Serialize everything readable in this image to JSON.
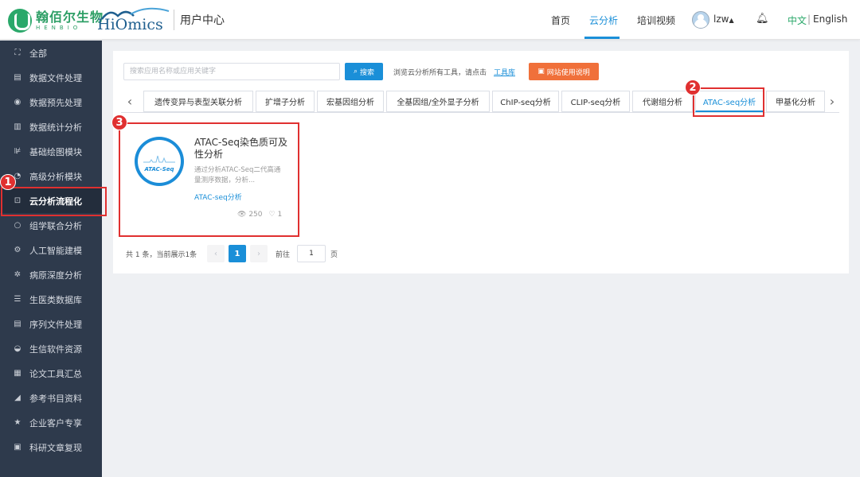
{
  "header": {
    "logo_cn": "翰佰尔生物",
    "logo_en": "HENBIO",
    "logo2_text": "HiOmics",
    "title": "用户中心",
    "nav": [
      "首页",
      "云分析",
      "培训视频"
    ],
    "username": "lzw",
    "lang_cn": "中文",
    "lang_sep": "|",
    "lang_en": "English",
    "accent_color": "#1a8fd8"
  },
  "sidebar": {
    "items": [
      {
        "icon": "⛶",
        "label": "全部"
      },
      {
        "icon": "▤",
        "label": "数据文件处理"
      },
      {
        "icon": "◉",
        "label": "数据预先处理"
      },
      {
        "icon": "▥",
        "label": "数据统计分析"
      },
      {
        "icon": "⊯",
        "label": "基础绘图模块"
      },
      {
        "icon": "◔",
        "label": "高级分析模块"
      },
      {
        "icon": "⊡",
        "label": "云分析流程化"
      },
      {
        "icon": "○",
        "label": "组学联合分析"
      },
      {
        "icon": "⚙",
        "label": "人工智能建模"
      },
      {
        "icon": "✲",
        "label": "病原深度分析"
      },
      {
        "icon": "☰",
        "label": "生医类数据库"
      },
      {
        "icon": "▤",
        "label": "序列文件处理"
      },
      {
        "icon": "◒",
        "label": "生信软件资源"
      },
      {
        "icon": "▦",
        "label": "论文工具汇总"
      },
      {
        "icon": "◢",
        "label": "参考书目资料"
      },
      {
        "icon": "★",
        "label": "企业客户专享"
      },
      {
        "icon": "▣",
        "label": "科研文章复现"
      }
    ],
    "active_index": 6
  },
  "search": {
    "placeholder": "搜索应用名称或应用关键字",
    "button_label": "搜索",
    "browse_text": "浏览云分析所有工具，请点击",
    "browse_link": "工具库",
    "guide_label": "网站使用说明"
  },
  "tabs": {
    "items": [
      "遗传变异与表型关联分析",
      "扩增子分析",
      "宏基因组分析",
      "全基因组/全外显子分析",
      "ChIP-seq分析",
      "CLIP-seq分析",
      "代谢组分析",
      "ATAC-seq分析",
      "甲基化分析"
    ],
    "active_index": 7,
    "prev_icon": "‹",
    "next_icon": "›"
  },
  "card": {
    "image_label": "ATAC-Seq",
    "title": "ATAC-Seq染色质可及性分析",
    "description": "通过分析ATAC-Seq二代高通量测序数据，分析...",
    "tag": "ATAC-seq分析",
    "views": "250",
    "likes": "1"
  },
  "pagination": {
    "info": "共 1 条，当前展示1条",
    "prev": "‹",
    "current": "1",
    "next": "›",
    "goto_label": "前往",
    "goto_value": "1",
    "page_label": "页"
  },
  "annotations": {
    "badge1": "1",
    "badge2": "2",
    "badge3": "3",
    "color": "#e03030"
  }
}
